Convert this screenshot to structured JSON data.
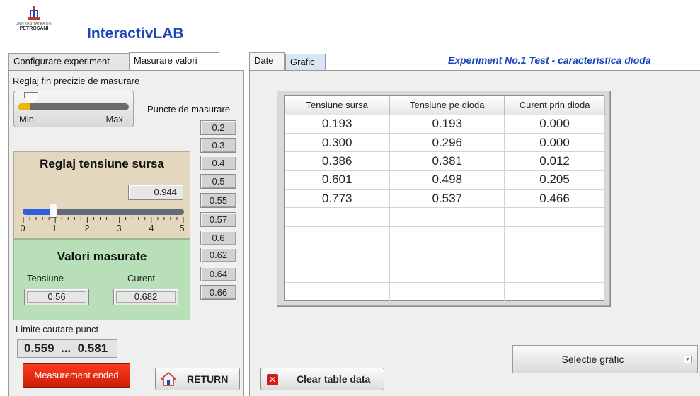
{
  "header": {
    "logo_university": "UNIVERSITATEA DIN",
    "logo_city": "PETROŞANI",
    "app_title": "InteractivLAB",
    "experiment_title": "Experiment No.1 Test - caracteristica dioda"
  },
  "tabs_left": [
    {
      "label": "Configurare experiment",
      "active": false
    },
    {
      "label": "Masurare valori",
      "active": true
    }
  ],
  "tabs_right": [
    {
      "label": "Date",
      "active": true
    },
    {
      "label": "Grafic",
      "active": false
    }
  ],
  "fine_adjust": {
    "label": "Reglaj fin precizie de masurare",
    "min_label": "Min",
    "max_label": "Max",
    "level": 0.1
  },
  "measure_points": {
    "label": "Puncte de masurare",
    "items": [
      "0.2",
      "0.3",
      "0.4",
      "0.5",
      "0.55",
      "0.57",
      "0.6",
      "0.62",
      "0.64",
      "0.66"
    ]
  },
  "voltage_adjust": {
    "title": "Reglaj tensiune sursa",
    "value": "0.944",
    "slider_min": 0,
    "slider_max": 5,
    "slider_value": 0.944,
    "tick_labels": [
      "0",
      "1",
      "2",
      "3",
      "4",
      "5"
    ]
  },
  "measured_values": {
    "title": "Valori masurate",
    "voltage_label": "Tensiune",
    "current_label": "Curent",
    "voltage_value": "0.56",
    "current_value": "0.682"
  },
  "search_limits": {
    "label": "Limite cautare punct",
    "value": "0.559  ...  0.581"
  },
  "buttons": {
    "measurement_ended": "Measurement ended",
    "return": "RETURN",
    "clear_table": "Clear table data",
    "select_chart": "Selectie grafic"
  },
  "table": {
    "headers": [
      "Tensiune sursa",
      "Tensiune pe dioda",
      "Curent prin dioda"
    ],
    "rows": [
      [
        "0.193",
        "0.193",
        "0.000"
      ],
      [
        "0.300",
        "0.296",
        "0.000"
      ],
      [
        "0.386",
        "0.381",
        "0.012"
      ],
      [
        "0.601",
        "0.498",
        "0.205"
      ],
      [
        "0.773",
        "0.537",
        "0.466"
      ],
      [
        "",
        "",
        ""
      ],
      [
        "",
        "",
        ""
      ],
      [
        "",
        "",
        ""
      ],
      [
        "",
        "",
        ""
      ],
      [
        "",
        "",
        ""
      ]
    ]
  },
  "colors": {
    "brand_blue": "#1a47b8",
    "voltage_box": "#e3d7bd",
    "measured_box": "#b9dfb9",
    "alert_red": "#e12a12",
    "slider_fill_blue": "#2e5ee0",
    "fine_fill_yellow": "#f1b400"
  }
}
